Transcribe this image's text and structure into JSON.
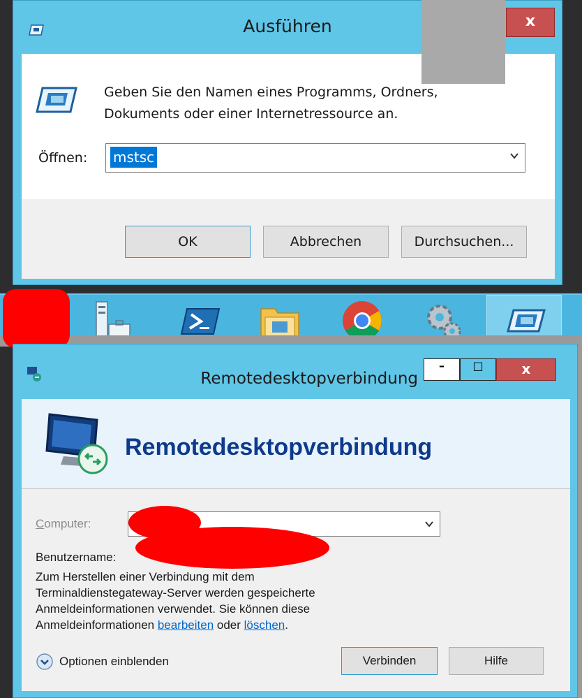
{
  "run_dialog": {
    "title": "Ausführen",
    "close_label": "x",
    "message": "Geben Sie den Namen eines Programms, Ordners, Dokuments oder einer Internetressource an.",
    "open_label": "Öffnen:",
    "open_value": "mstsc",
    "buttons": {
      "ok": "OK",
      "cancel": "Abbrechen",
      "browse": "Durchsuchen..."
    }
  },
  "taskbar": {
    "items": [
      {
        "icon": "server-manager-icon"
      },
      {
        "icon": "powershell-icon"
      },
      {
        "icon": "file-explorer-icon"
      },
      {
        "icon": "chrome-icon"
      },
      {
        "icon": "settings-gears-icon"
      },
      {
        "icon": "run-dialog-icon",
        "active": true
      }
    ]
  },
  "rdp_dialog": {
    "title": "Remotedesktopverbindung",
    "controls": {
      "minimize": "–",
      "maximize": "□",
      "close": "x"
    },
    "banner_title": "Remotedesktopverbindung",
    "computer_label": "Computer:",
    "username_label": "Benutzername:",
    "info_line1": "Zum Herstellen einer Verbindung mit dem",
    "info_line2": "Terminaldienstegateway-Server werden gespeicherte",
    "info_line3": "Anmeldeinformationen verwendet. Sie können diese",
    "info_line4_prefix": "Anmeldeinformationen ",
    "info_edit_link": "bearbeiten",
    "info_or": " oder ",
    "info_delete_link": "löschen",
    "info_end": ".",
    "options_label": "Optionen einblenden",
    "buttons": {
      "connect": "Verbinden",
      "help": "Hilfe"
    }
  },
  "colors": {
    "title_bar": "#5fc6e8",
    "taskbar": "#4ab6df",
    "close_button": "#c75050",
    "selection": "#0078d7",
    "banner_title": "#0e3a8c",
    "redaction": "#ff0000"
  }
}
